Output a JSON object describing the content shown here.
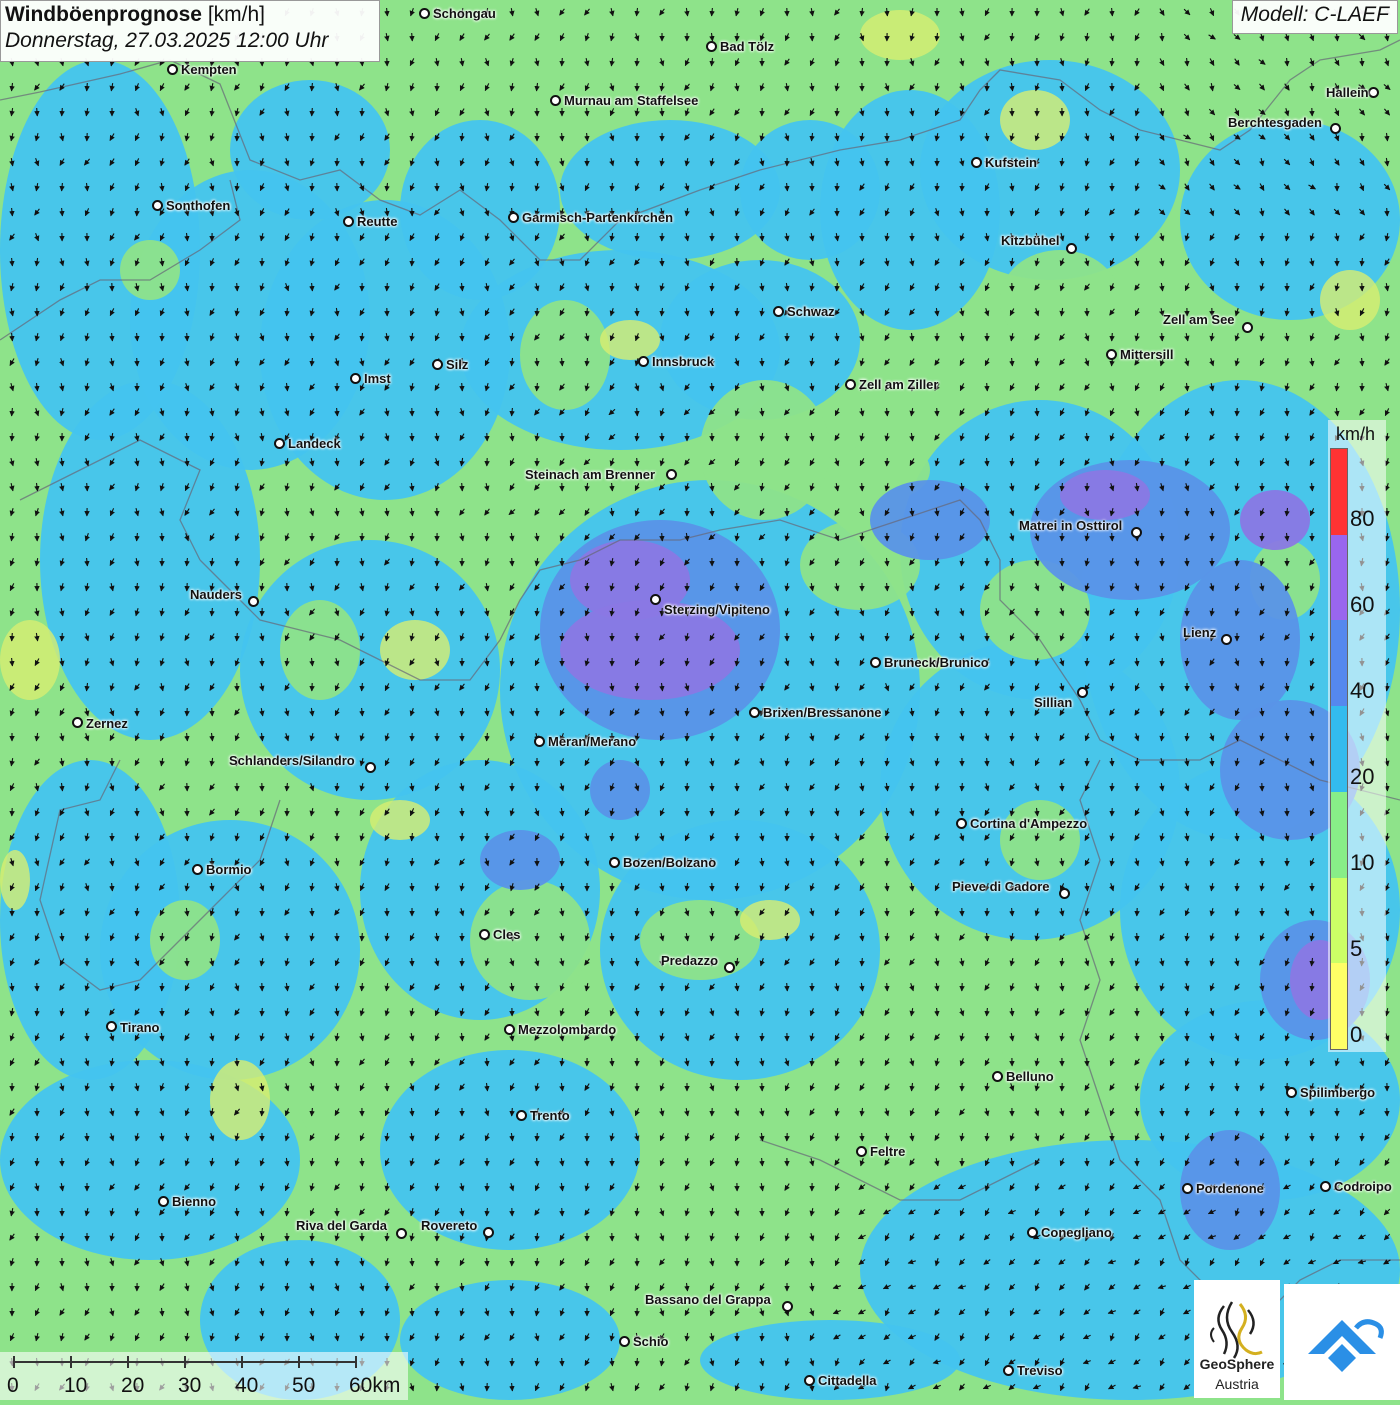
{
  "header": {
    "title_bold": "Windböenprognose",
    "title_unit": "[km/h]",
    "datetime": "Donnerstag, 27.03.2025 12:00 Uhr",
    "model": "Modell: C-LAEF"
  },
  "legend": {
    "unit": "km/h",
    "ticks": [
      "0",
      "5",
      "10",
      "20",
      "40",
      "60",
      "80"
    ],
    "colors": [
      "#ffff66",
      "#ccff66",
      "#88ee88",
      "#33bbee",
      "#5588ee",
      "#9966ee",
      "#ff3333"
    ]
  },
  "scalebar": {
    "labels": [
      "0",
      "10",
      "20",
      "30",
      "40",
      "50",
      "60km"
    ]
  },
  "logos": {
    "geosphere_line1": "GeoSphere",
    "geosphere_line2": "Austria"
  },
  "colors": {
    "green": "#8ee38a",
    "blue": "#44c4ef",
    "darkblue": "#5a94e8",
    "purple": "#8a78e4",
    "yellow": "#d8ee70"
  },
  "cities": [
    "Schongau",
    "Bad Tölz",
    "Kempten",
    "Murnau am Staffelsee",
    "Hallein",
    "Berchtesgaden",
    "Kufstein",
    "Sonthofen",
    "Reutte",
    "Garmisch-Partenkirchen",
    "Kitzbühel",
    "Schwaz",
    "Zell am See",
    "Mittersill",
    "Innsbruck",
    "Imst",
    "Silz",
    "Zell am Ziller",
    "Landeck",
    "Steinach am Brenner",
    "Matrei in Osttirol",
    "Nauders",
    "Sterzing/Vipiteno",
    "Lienz",
    "Bruneck/Brunico",
    "Sillian",
    "Zernez",
    "Brixen/Bressanone",
    "Meran/Merano",
    "Schlanders/Silandro",
    "Cortina d'Ampezzo",
    "Bormio",
    "Bozen/Bolzano",
    "Pieve di Cadore",
    "Cles",
    "Predazzo",
    "Tirano",
    "Mezzolombardo",
    "Belluno",
    "Spilimbergo",
    "Trento",
    "Feltre",
    "Pordenone",
    "Codroipo",
    "Bienno",
    "Riva del Garda",
    "Rovereto",
    "Conegliano",
    "Bassano del Grappa",
    "Schio",
    "Treviso",
    "Cittadella"
  ]
}
